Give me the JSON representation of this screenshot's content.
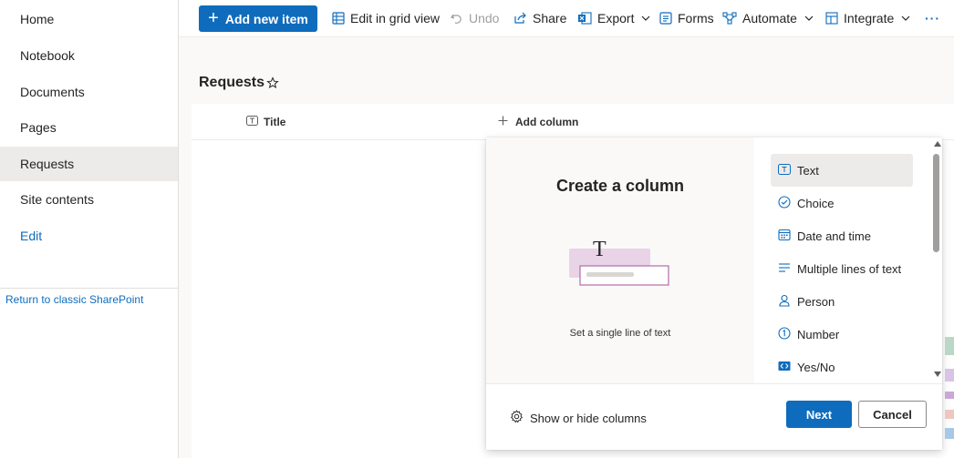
{
  "left_nav": {
    "items": [
      {
        "label": "Home"
      },
      {
        "label": "Notebook"
      },
      {
        "label": "Documents"
      },
      {
        "label": "Pages"
      },
      {
        "label": "Requests",
        "selected": true
      },
      {
        "label": "Site contents"
      },
      {
        "label": "Edit"
      }
    ],
    "classic_link": "Return to classic SharePoint"
  },
  "command_bar": {
    "add_new_item": "Add new item",
    "edit_grid": "Edit in grid view",
    "undo": "Undo",
    "share": "Share",
    "export": "Export",
    "forms": "Forms",
    "automate": "Automate",
    "integrate": "Integrate",
    "more": "···"
  },
  "list": {
    "title": "Requests",
    "columns": {
      "title": "Title",
      "add_column": "Add column"
    }
  },
  "create_column_panel": {
    "heading": "Create a column",
    "description": "Set a single line of text",
    "illustration_glyph": "T",
    "types": [
      {
        "label": "Text",
        "icon": "text-field-icon",
        "selected": true
      },
      {
        "label": "Choice",
        "icon": "choice-check-icon"
      },
      {
        "label": "Date and time",
        "icon": "calendar-icon"
      },
      {
        "label": "Multiple lines of text",
        "icon": "multiline-text-icon"
      },
      {
        "label": "Person",
        "icon": "person-icon"
      },
      {
        "label": "Number",
        "icon": "number-icon"
      },
      {
        "label": "Yes/No",
        "icon": "toggle-icon"
      }
    ],
    "show_hide": "Show or hide columns",
    "next": "Next",
    "cancel": "Cancel"
  },
  "colors": {
    "accent": "#0f6cbd",
    "nav_selected": "#edebe9",
    "panel_preview_bg": "#faf9f8",
    "illustration_pink": "#e8d4e6",
    "illustration_border": "#b56aab"
  }
}
